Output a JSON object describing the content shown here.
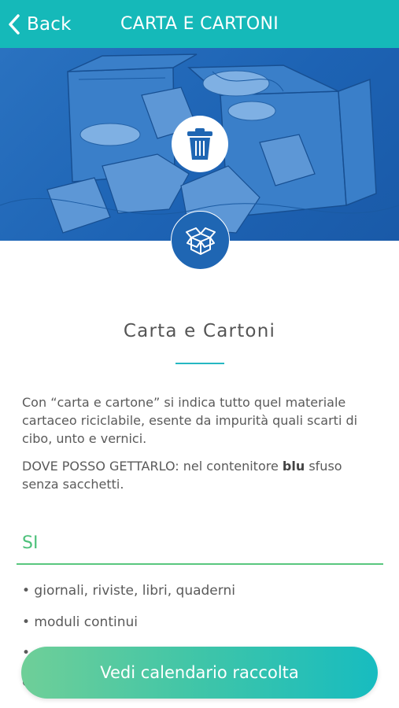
{
  "navbar": {
    "back_label": "Back",
    "title": "CARTA E CARTONI",
    "color": "#15b9b9"
  },
  "hero": {
    "bg_color": "#1d63b4",
    "top_icon": "trash-bin-icon",
    "bottom_icon": "open-box-icon"
  },
  "content": {
    "title": "Carta e Cartoni",
    "description": "Con “carta e cartone” si indica tutto quel materiale cartaceo riciclabile, esente da impurità quali scarti di cibo, unto e vernici.",
    "where_prefix": "DOVE POSSO GETTARLO: nel contenitore",
    "where_color": "blu",
    "where_suffix": "sfuso senza sacchetti."
  },
  "si_section": {
    "heading": "SI",
    "accent": "#4cc07a",
    "items": [
      "• giornali, riviste, libri, quaderni",
      "• moduli continui",
      "•",
      "c"
    ]
  },
  "cta": {
    "label": "Vedi calendario raccolta"
  }
}
